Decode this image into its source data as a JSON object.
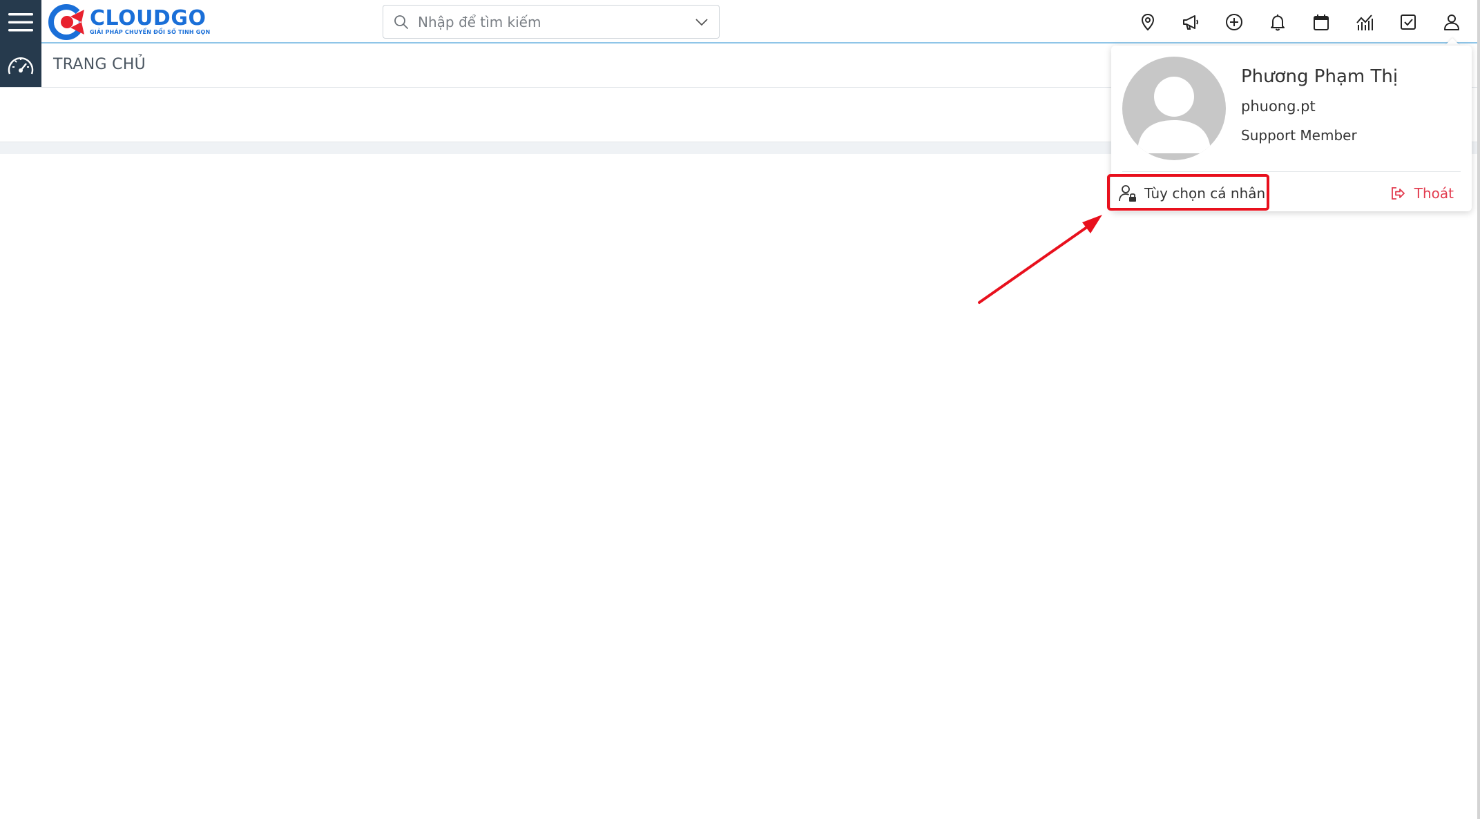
{
  "brand": {
    "name": "CLOUDGO",
    "tagline": "GIẢI PHÁP CHUYỂN ĐỔI SỐ TINH GỌN",
    "color": "#1a6fd8",
    "accent": "#e8212e"
  },
  "search": {
    "placeholder": "Nhập để tìm kiếm"
  },
  "toolbar": {
    "icons": [
      "location-pin-icon",
      "megaphone-icon",
      "plus-circle-icon",
      "bell-icon",
      "calendar-icon",
      "chart-icon",
      "checkbox-icon",
      "user-icon"
    ]
  },
  "page": {
    "title": "TRANG CHỦ"
  },
  "user_menu": {
    "full_name": "Phương Phạm Thị",
    "username": "phuong.pt",
    "role": "Support Member",
    "preferences_label": "Tùy chọn cá nhân",
    "logout_label": "Thoát",
    "logout_color": "#e23b4e"
  },
  "annotation": {
    "color": "#e8101d"
  }
}
